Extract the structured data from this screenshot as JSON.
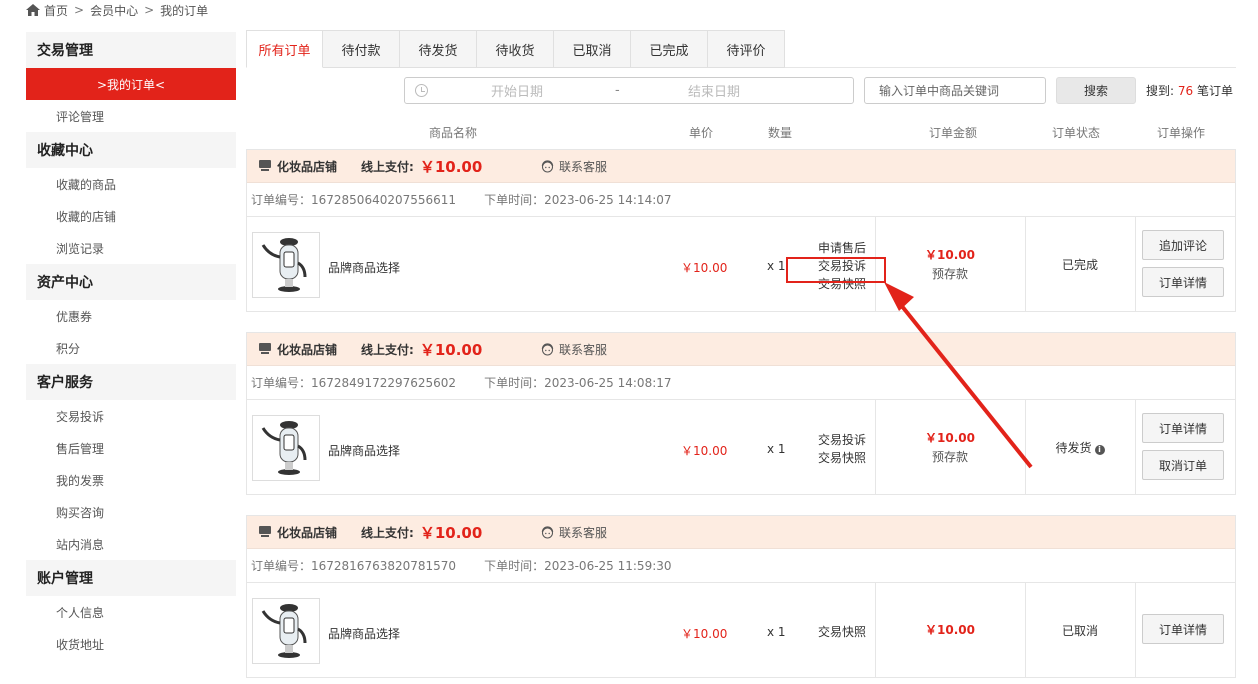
{
  "breadcrumb": {
    "home": "首页",
    "sep": ">",
    "member": "会员中心",
    "current": "我的订单"
  },
  "sidebar": {
    "groups": [
      {
        "title": "交易管理",
        "items": [
          ">我的订单<",
          "评论管理"
        ]
      },
      {
        "title": "收藏中心",
        "items": [
          "收藏的商品",
          "收藏的店铺",
          "浏览记录"
        ]
      },
      {
        "title": "资产中心",
        "items": [
          "优惠券",
          "积分"
        ]
      },
      {
        "title": "客户服务",
        "items": [
          "交易投诉",
          "售后管理",
          "我的发票",
          "购买咨询",
          "站内消息"
        ]
      },
      {
        "title": "账户管理",
        "items": [
          "个人信息",
          "收货地址"
        ]
      }
    ]
  },
  "tabs": [
    "所有订单",
    "待付款",
    "待发货",
    "待收货",
    "已取消",
    "已完成",
    "待评价"
  ],
  "filter": {
    "start_placeholder": "开始日期",
    "dash": "-",
    "end_placeholder": "结束日期",
    "keyword_placeholder": "输入订单中商品关键词",
    "search_label": "搜索",
    "result_prefix": "搜到:",
    "result_count": "76",
    "result_suffix": "笔订单"
  },
  "table_header": {
    "name": "商品名称",
    "price": "单价",
    "qty": "数量",
    "amount": "订单金额",
    "status": "订单状态",
    "ops": "订单操作"
  },
  "orders": [
    {
      "shop": "化妆品店铺",
      "pay_label": "线上支付:",
      "pay_amount": "￥10.00",
      "cs": "联系客服",
      "order_no": "订单编号：1672850640207556611",
      "order_time": "下单时间：2023-06-25 14:14:07",
      "product": "品牌商品选择",
      "price": "￥10.00",
      "qty": "x 1",
      "services": [
        "申请售后",
        "交易投诉",
        "交易快照"
      ],
      "amount": "￥10.00",
      "amount_note": "预存款",
      "status": "已完成",
      "ops": [
        "追加评论",
        "订单详情"
      ]
    },
    {
      "shop": "化妆品店铺",
      "pay_label": "线上支付:",
      "pay_amount": "￥10.00",
      "cs": "联系客服",
      "order_no": "订单编号：1672849172297625602",
      "order_time": "下单时间：2023-06-25 14:08:17",
      "product": "品牌商品选择",
      "price": "￥10.00",
      "qty": "x 1",
      "services": [
        "交易投诉",
        "交易快照"
      ],
      "amount": "￥10.00",
      "amount_note": "预存款",
      "status": "待发货",
      "ops": [
        "订单详情",
        "取消订单"
      ]
    },
    {
      "shop": "化妆品店铺",
      "pay_label": "线上支付:",
      "pay_amount": "￥10.00",
      "cs": "联系客服",
      "order_no": "订单编号：1672816763820781570",
      "order_time": "下单时间：2023-06-25 11:59:30",
      "product": "品牌商品选择",
      "price": "￥10.00",
      "qty": "x 1",
      "services": [
        "交易快照"
      ],
      "amount": "￥10.00",
      "amount_note": "",
      "status": "已取消",
      "ops": [
        "订单详情"
      ]
    }
  ],
  "colors": {
    "accent": "#e2231a",
    "order_header_bg": "#fdece1"
  },
  "icons": [
    "home-icon",
    "clock-icon",
    "shop-icon",
    "customer-service-icon",
    "info-icon",
    "robot-product-image"
  ]
}
